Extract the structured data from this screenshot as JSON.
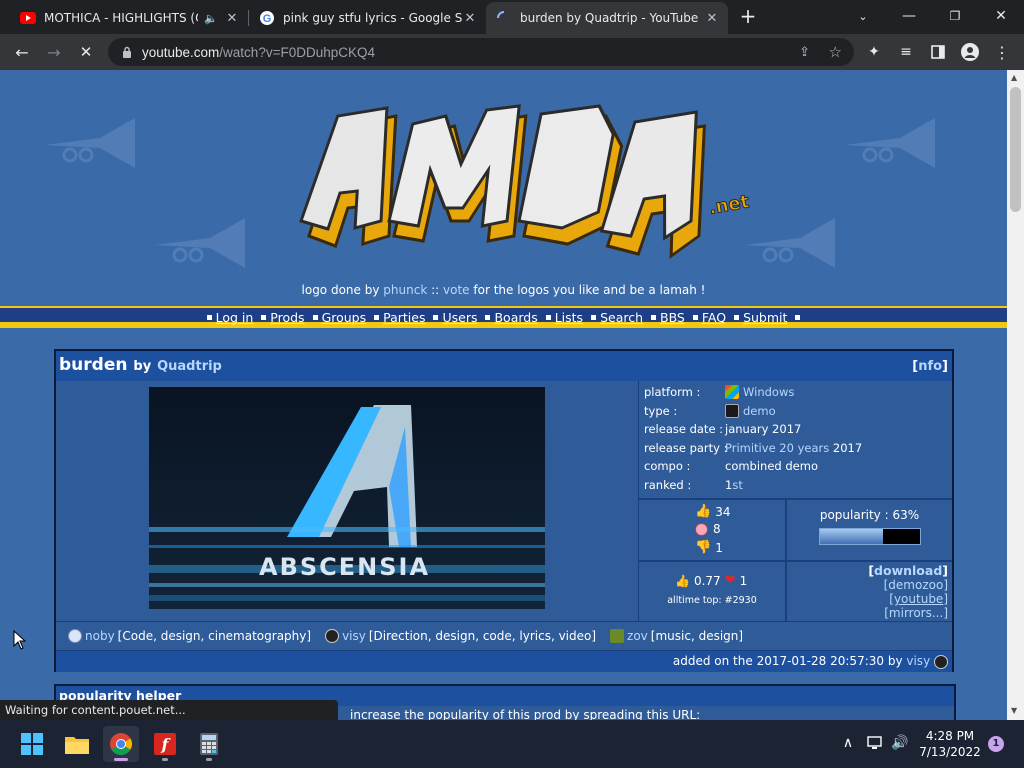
{
  "browser": {
    "tabs": [
      {
        "title": "MOTHICA - HIGHLIGHTS (Of",
        "icon": "youtube-icon",
        "audio": true
      },
      {
        "title": "pink guy stfu lyrics - Google Sear",
        "icon": "google-icon"
      },
      {
        "title": "burden by Quadtrip - YouTube",
        "icon": "loading-icon",
        "active": true
      }
    ],
    "url_host": "youtube.com",
    "url_path": "/watch?v=F0DDuhpCKQ4"
  },
  "site": {
    "logo_text": "AMDUAN .net",
    "logo_credit": {
      "prefix": "logo done by",
      "author": "phunck",
      "sep": "::",
      "vote": "vote",
      "suffix": "for the logos you like and be a lamah !"
    },
    "nav": [
      "Log in",
      "Prods",
      "Groups",
      "Parties",
      "Users",
      "Boards",
      "Lists",
      "Search",
      "BBS",
      "FAQ",
      "Submit"
    ]
  },
  "prod": {
    "title": "burden",
    "by": "by",
    "group": "Quadtrip",
    "nfo": "nfo",
    "screenshot_text": "ABSCENSIA",
    "info": {
      "platform_label": "platform :",
      "platform": "Windows",
      "type_label": "type :",
      "type": "demo",
      "release_date_label": "release date :",
      "release_date": "january 2017",
      "release_party_label": "release party :",
      "release_party": "Primitive 20 years",
      "release_party_year": "2017",
      "compo_label": "compo :",
      "compo": "combined demo",
      "ranked_label": "ranked :",
      "ranked_num": "1",
      "ranked_suffix": "st"
    },
    "votes": {
      "thumbs_up": "34",
      "piggie": "8",
      "thumbs_down": "1"
    },
    "popularity": {
      "label": "popularity : 63%",
      "value": 0.63
    },
    "average": {
      "score": "0.77",
      "cdcs": "1",
      "alltime_top": "alltime top: #2930"
    },
    "links": {
      "download": "download",
      "demozoo": "demozoo",
      "youtube": "youtube",
      "mirrors": "mirrors..."
    },
    "credits": [
      {
        "name": "noby",
        "role": "[Code, design, cinematography]"
      },
      {
        "name": "visy",
        "role": "[Direction, design, code, lyrics, video]"
      },
      {
        "name": "zov",
        "role": "[music, design]"
      }
    ],
    "added": {
      "prefix": "added on the 2017-01-28 20:57:30 by",
      "user": "visy"
    }
  },
  "popularity_helper": {
    "title": "popularity helper",
    "text": "increase the popularity of this prod by spreading this URL:"
  },
  "status_text": "Waiting for content.pouet.net...",
  "taskbar": {
    "time": "4:28 PM",
    "date": "7/13/2022",
    "notifications": "1"
  },
  "colors": {
    "page_bg": "#3b6aa8",
    "panel": "#2f5c98",
    "header": "#1e50a0",
    "link": "#b7d7ff",
    "accent_yellow": "#f2c80f"
  }
}
